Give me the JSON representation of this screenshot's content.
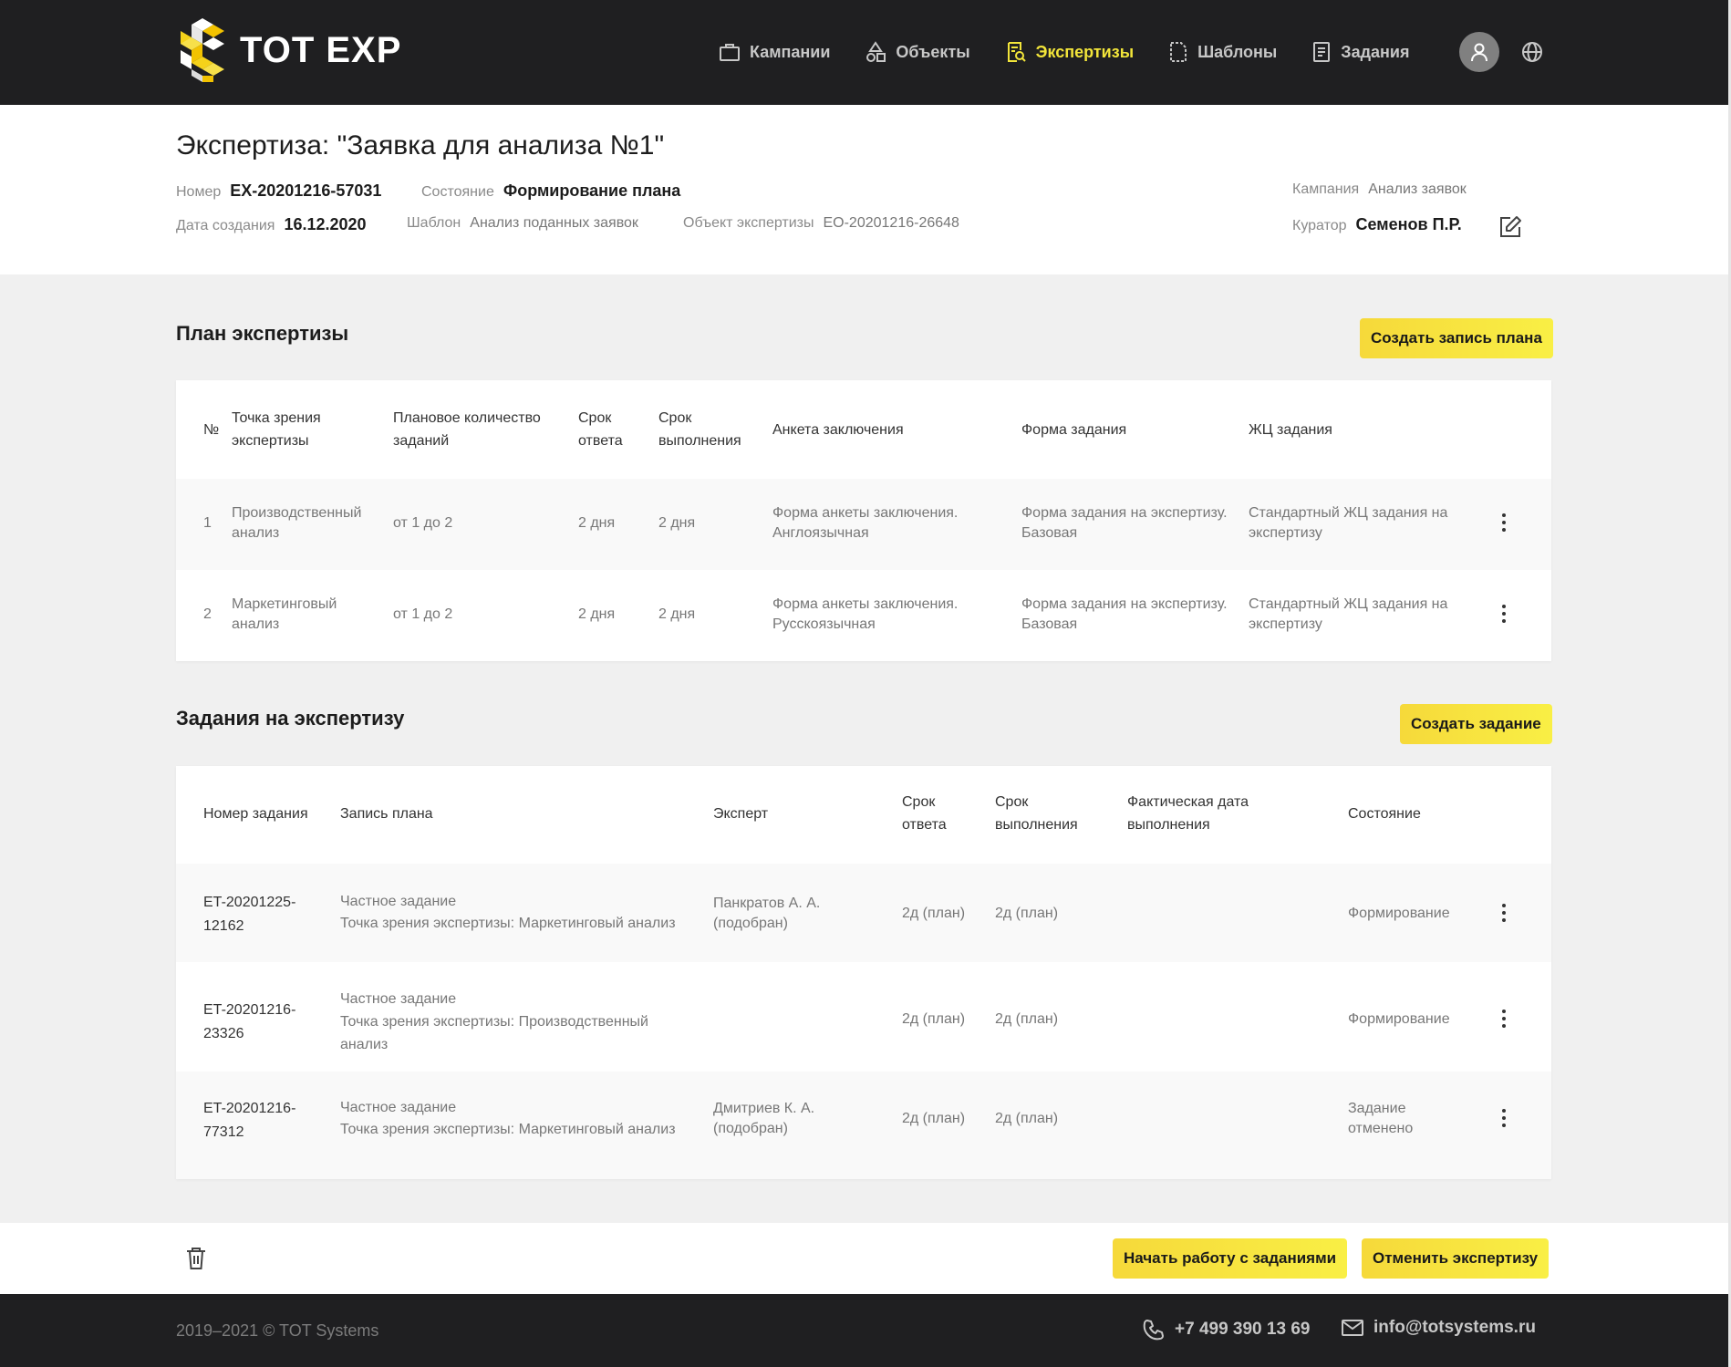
{
  "app": {
    "name": "TOT EXP"
  },
  "nav": [
    {
      "label": "Кампании",
      "icon": "briefcase-icon",
      "active": false
    },
    {
      "label": "Объекты",
      "icon": "shapes-icon",
      "active": false
    },
    {
      "label": "Экспертизы",
      "icon": "search-doc-icon",
      "active": true
    },
    {
      "label": "Шаблоны",
      "icon": "template-icon",
      "active": false
    },
    {
      "label": "Задания",
      "icon": "task-icon",
      "active": false
    }
  ],
  "colors": {
    "accent": "#f2e53a",
    "header_bg": "#1f1f21",
    "button": "#f6e23c"
  },
  "expertise": {
    "title": "Экспертиза: \"Заявка для анализа №1\"",
    "number_label": "Номер",
    "number": "EX-20201216-57031",
    "state_label": "Состояние",
    "state": "Формирование плана",
    "created_label": "Дата создания",
    "created": "16.12.2020",
    "template_label": "Шаблон",
    "template": "Анализ поданных заявок",
    "object_label": "Объект экспертизы",
    "object": "EO-20201216-26648",
    "campaign_label": "Кампания",
    "campaign": "Анализ заявок",
    "curator_label": "Куратор",
    "curator": "Семенов П.Р."
  },
  "plan": {
    "title": "План экспертизы",
    "create_button": "Создать запись плана",
    "headers": {
      "num": "№",
      "viewpoint_1": "Точка зрения",
      "viewpoint_2": "экспертизы",
      "count_1": "Плановое количество",
      "count_2": "заданий",
      "answer_1": "Срок",
      "answer_2": "ответа",
      "exec_1": "Срок",
      "exec_2": "выполнения",
      "form": "Анкета заключения",
      "task_form": "Форма задания",
      "lifecycle": "ЖЦ задания"
    },
    "rows": [
      {
        "num": "1",
        "viewpoint_1": "Производственный",
        "viewpoint_2": "анализ",
        "count": "от 1 до 2",
        "answer": "2 дня",
        "exec": "2 дня",
        "form_1": "Форма анкеты заключения.",
        "form_2": "Англоязычная",
        "task_form_1": "Форма задания на экспертизу.",
        "task_form_2": "Базовая",
        "lifecycle_1": "Стандартный ЖЦ задания на",
        "lifecycle_2": "экспертизу"
      },
      {
        "num": "2",
        "viewpoint_1": "Маркетинговый",
        "viewpoint_2": "анализ",
        "count": "от 1 до 2",
        "answer": "2 дня",
        "exec": "2 дня",
        "form_1": "Форма анкеты заключения.",
        "form_2": "Русскоязычная",
        "task_form_1": "Форма задания на экспертизу.",
        "task_form_2": "Базовая",
        "lifecycle_1": "Стандартный ЖЦ задания на",
        "lifecycle_2": "экспертизу"
      }
    ]
  },
  "tasks": {
    "title": "Задания на экспертизу",
    "create_button": "Создать задание",
    "headers": {
      "number": "Номер задания",
      "plan": "Запись плана",
      "expert": "Эксперт",
      "answer_1": "Срок",
      "answer_2": "ответа",
      "exec_1": "Срок",
      "exec_2": "выполнения",
      "actual_1": "Фактическая дата",
      "actual_2": "выполнения",
      "state": "Состояние"
    },
    "rows": [
      {
        "number_1": "ET-20201225-",
        "number_2": "12162",
        "plan_1": "Частное задание",
        "plan_2": "Точка зрения экспертизы: Маркетинговый анализ",
        "plan_3": "",
        "expert_1": "Панкратов А. А.",
        "expert_2": "(подобран)",
        "answer": "2д (план)",
        "exec": "2д (план)",
        "state_1": "Формирование",
        "state_2": ""
      },
      {
        "number_1": "ET-20201216-",
        "number_2": "23326",
        "plan_1": "Частное задание",
        "plan_2": "Точка зрения экспертизы: Производственный",
        "plan_3": "анализ",
        "expert_1": "",
        "expert_2": "",
        "answer": "2д (план)",
        "exec": "2д (план)",
        "state_1": "Формирование",
        "state_2": ""
      },
      {
        "number_1": "ET-20201216-",
        "number_2": "77312",
        "plan_1": "Частное задание",
        "plan_2": "Точка зрения экспертизы: Маркетинговый анализ",
        "plan_3": "",
        "expert_1": "Дмитриев К. А.",
        "expert_2": "(подобран)",
        "answer": "2д (план)",
        "exec": "2д (план)",
        "state_1": "Задание",
        "state_2": "отменено"
      }
    ]
  },
  "actions": {
    "start": "Начать работу с заданиями",
    "cancel": "Отменить экспертизу"
  },
  "footer": {
    "copyright": "2019–2021 © TOT Systems",
    "phone": "+7 499 390 13 69",
    "email": "info@totsystems.ru"
  }
}
